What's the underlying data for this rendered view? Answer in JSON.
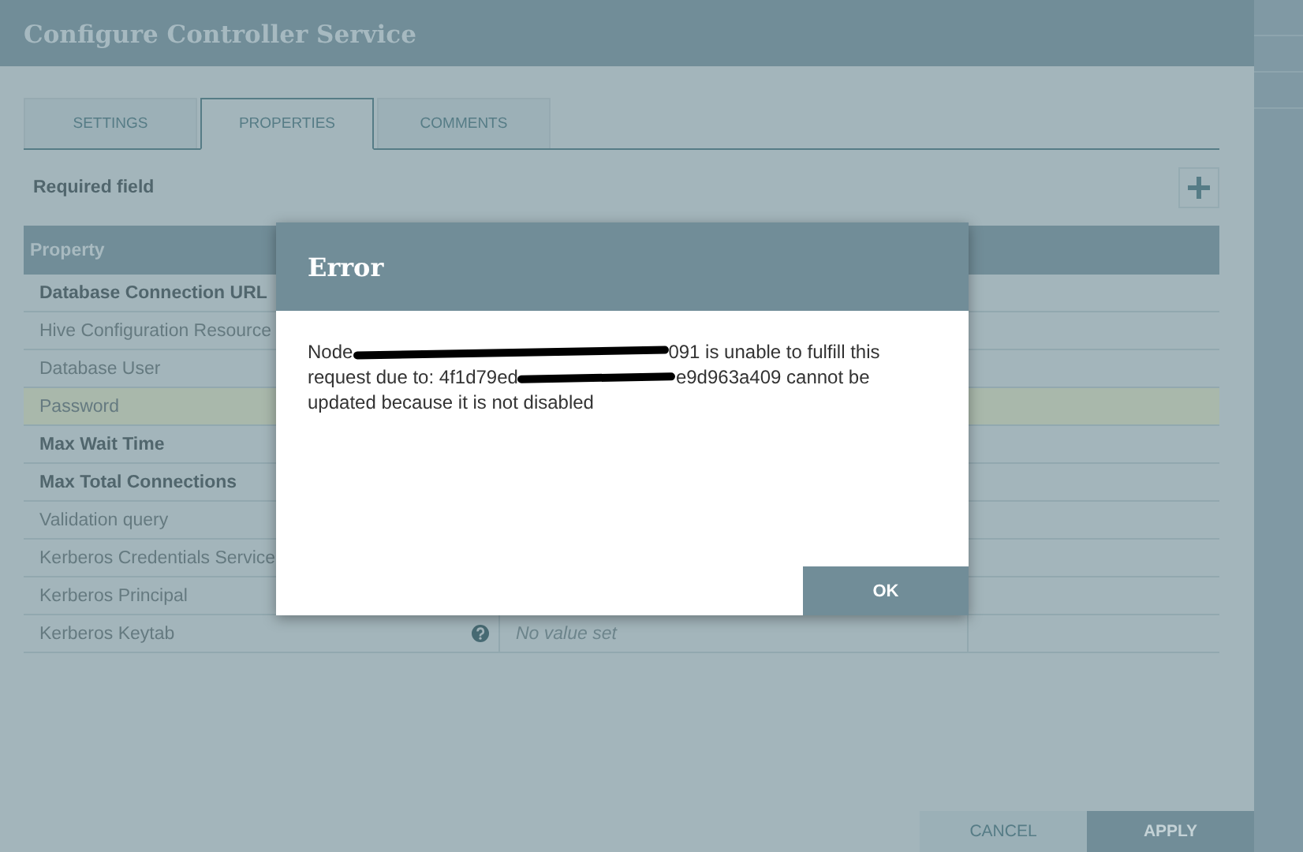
{
  "window": {
    "title": "Configure Controller Service"
  },
  "tabs": [
    {
      "label": "SETTINGS",
      "selected": false
    },
    {
      "label": "PROPERTIES",
      "selected": true
    },
    {
      "label": "COMMENTS",
      "selected": false
    }
  ],
  "required_label": "Required field",
  "table": {
    "columns": [
      "Property"
    ],
    "rows": [
      {
        "name": "Database Connection URL",
        "required": true,
        "highlighted": false
      },
      {
        "name": "Hive Configuration Resource",
        "required": false,
        "highlighted": false
      },
      {
        "name": "Database User",
        "required": false,
        "highlighted": false
      },
      {
        "name": "Password",
        "required": false,
        "highlighted": true
      },
      {
        "name": "Max Wait Time",
        "required": true,
        "highlighted": false
      },
      {
        "name": "Max Total Connections",
        "required": true,
        "highlighted": false
      },
      {
        "name": "Validation query",
        "required": false,
        "highlighted": false
      },
      {
        "name": "Kerberos Credentials Service",
        "required": false,
        "highlighted": false
      },
      {
        "name": "Kerberos Principal",
        "required": false,
        "highlighted": false
      },
      {
        "name": "Kerberos Keytab",
        "required": false,
        "highlighted": false,
        "help": true,
        "value": "No value set"
      }
    ]
  },
  "buttons": [
    {
      "label": "CANCEL",
      "kind": "secondary"
    },
    {
      "label": "APPLY",
      "kind": "primary"
    }
  ],
  "dialog": {
    "title": "Error",
    "message": [
      {
        "kind": "text",
        "text": "Node"
      },
      {
        "kind": "redaction"
      },
      {
        "kind": "text",
        "text": "091 is unable to fulfill this request due to: 4f1d79ed"
      },
      {
        "kind": "redaction"
      },
      {
        "kind": "text",
        "text": "e9d963a409 cannot be updated because it is not disabled"
      }
    ],
    "button": "OK"
  }
}
